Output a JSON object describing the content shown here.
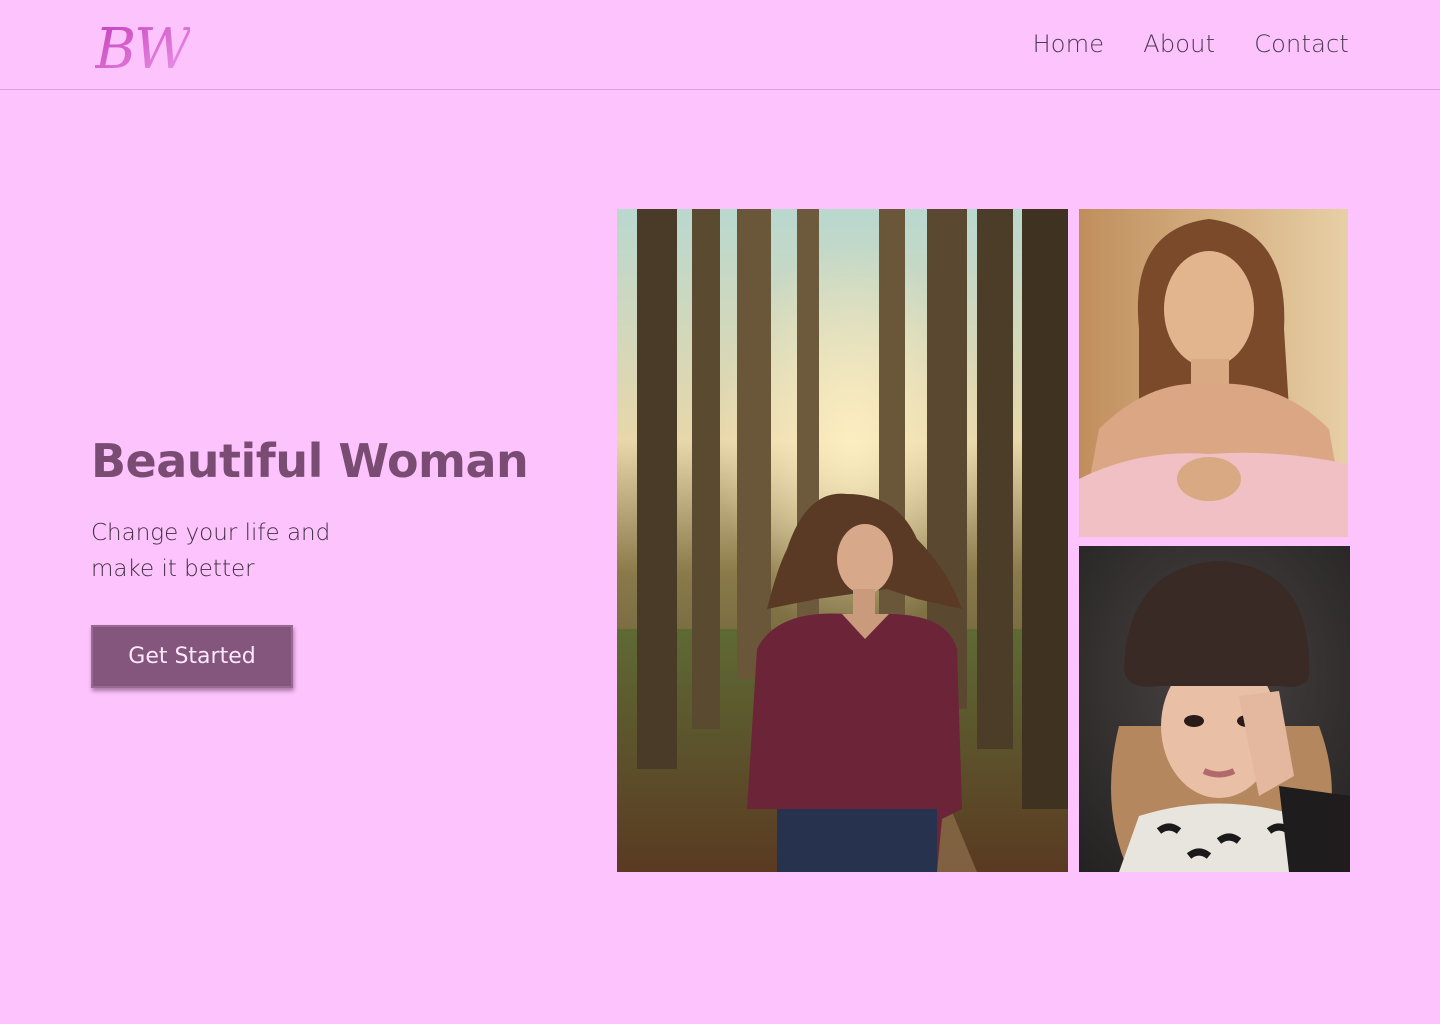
{
  "brand": {
    "logo_text": "BW"
  },
  "nav": {
    "items": [
      {
        "label": "Home"
      },
      {
        "label": "About"
      },
      {
        "label": "Contact"
      }
    ]
  },
  "hero": {
    "title": "Beautiful Woman",
    "subtitle": "Change your life and make it better",
    "cta_label": "Get Started"
  },
  "colors": {
    "background": "#fdc3fd",
    "title": "#7a4c74",
    "button": "#84567e",
    "button_text": "#fde8fd",
    "nav_text": "#4a3a4e"
  }
}
